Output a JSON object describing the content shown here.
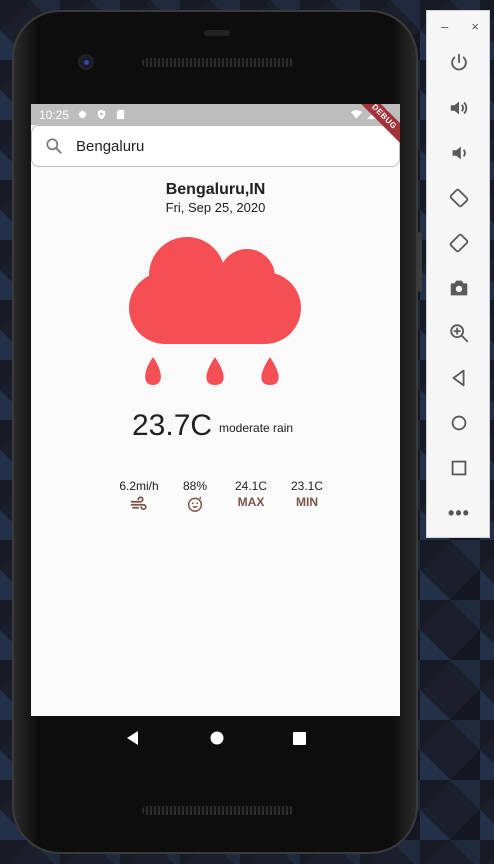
{
  "status_bar": {
    "time": "10:25",
    "debug_label": "DEBUG"
  },
  "search": {
    "value": "Bengaluru"
  },
  "weather": {
    "city": "Bengaluru,IN",
    "date": "Fri, Sep 25, 2020",
    "condition_icon": "rain-cloud-icon",
    "temperature": "23.7C",
    "description": "moderate rain",
    "accent_color": "#f44f54"
  },
  "stats": {
    "wind": {
      "value": "6.2mi/h",
      "icon": "wind-icon"
    },
    "humidity": {
      "value": "88%",
      "icon": "humidity-face-icon"
    },
    "max": {
      "value": "24.1C",
      "label": "MAX"
    },
    "min": {
      "value": "23.1C",
      "label": "MIN"
    }
  },
  "colors": {
    "stat_label": "#795548",
    "status_bar": "#bdbdbd"
  },
  "emulator_toolbar": {
    "minimize": "–",
    "close": "×",
    "more": "•••",
    "buttons": [
      "power-icon",
      "volume-up-icon",
      "volume-down-icon",
      "rotate-left-icon",
      "rotate-right-icon",
      "camera-icon",
      "zoom-icon",
      "back-icon",
      "home-icon",
      "overview-icon"
    ]
  }
}
